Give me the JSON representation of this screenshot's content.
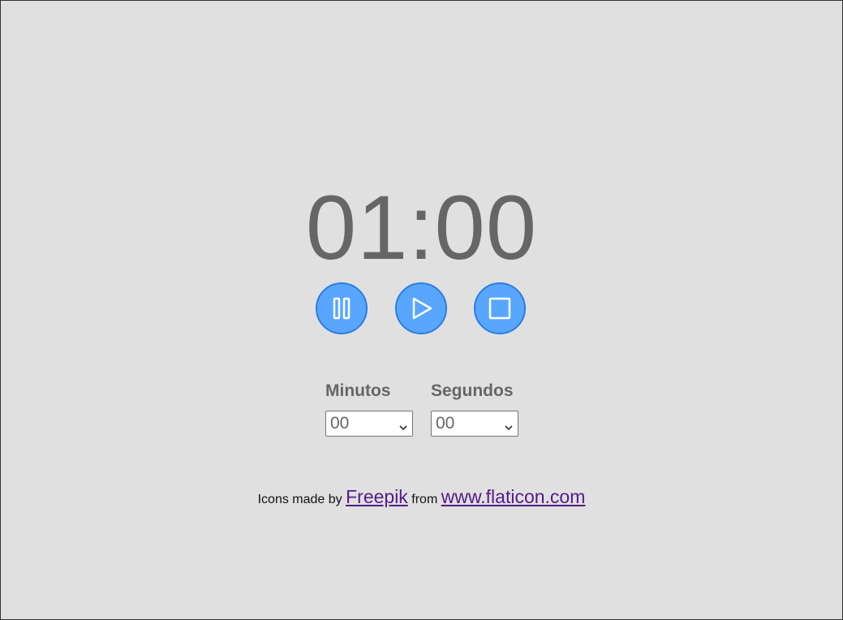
{
  "timer": {
    "display": "01:00"
  },
  "controls": {
    "pause_icon": "pause-icon",
    "play_icon": "play-icon",
    "stop_icon": "stop-icon",
    "button_color": "#58a6ff",
    "button_border": "#2b7de0"
  },
  "selectors": {
    "minutes": {
      "label": "Minutos",
      "value": "00"
    },
    "seconds": {
      "label": "Segundos",
      "value": "00"
    }
  },
  "credits": {
    "prefix": "Icons made by",
    "author_link": "Freepik",
    "middle": "from",
    "site_link": "www.flaticon.com"
  },
  "colors": {
    "background": "#e0e0e0",
    "text": "#666666",
    "link": "#551a8b"
  }
}
